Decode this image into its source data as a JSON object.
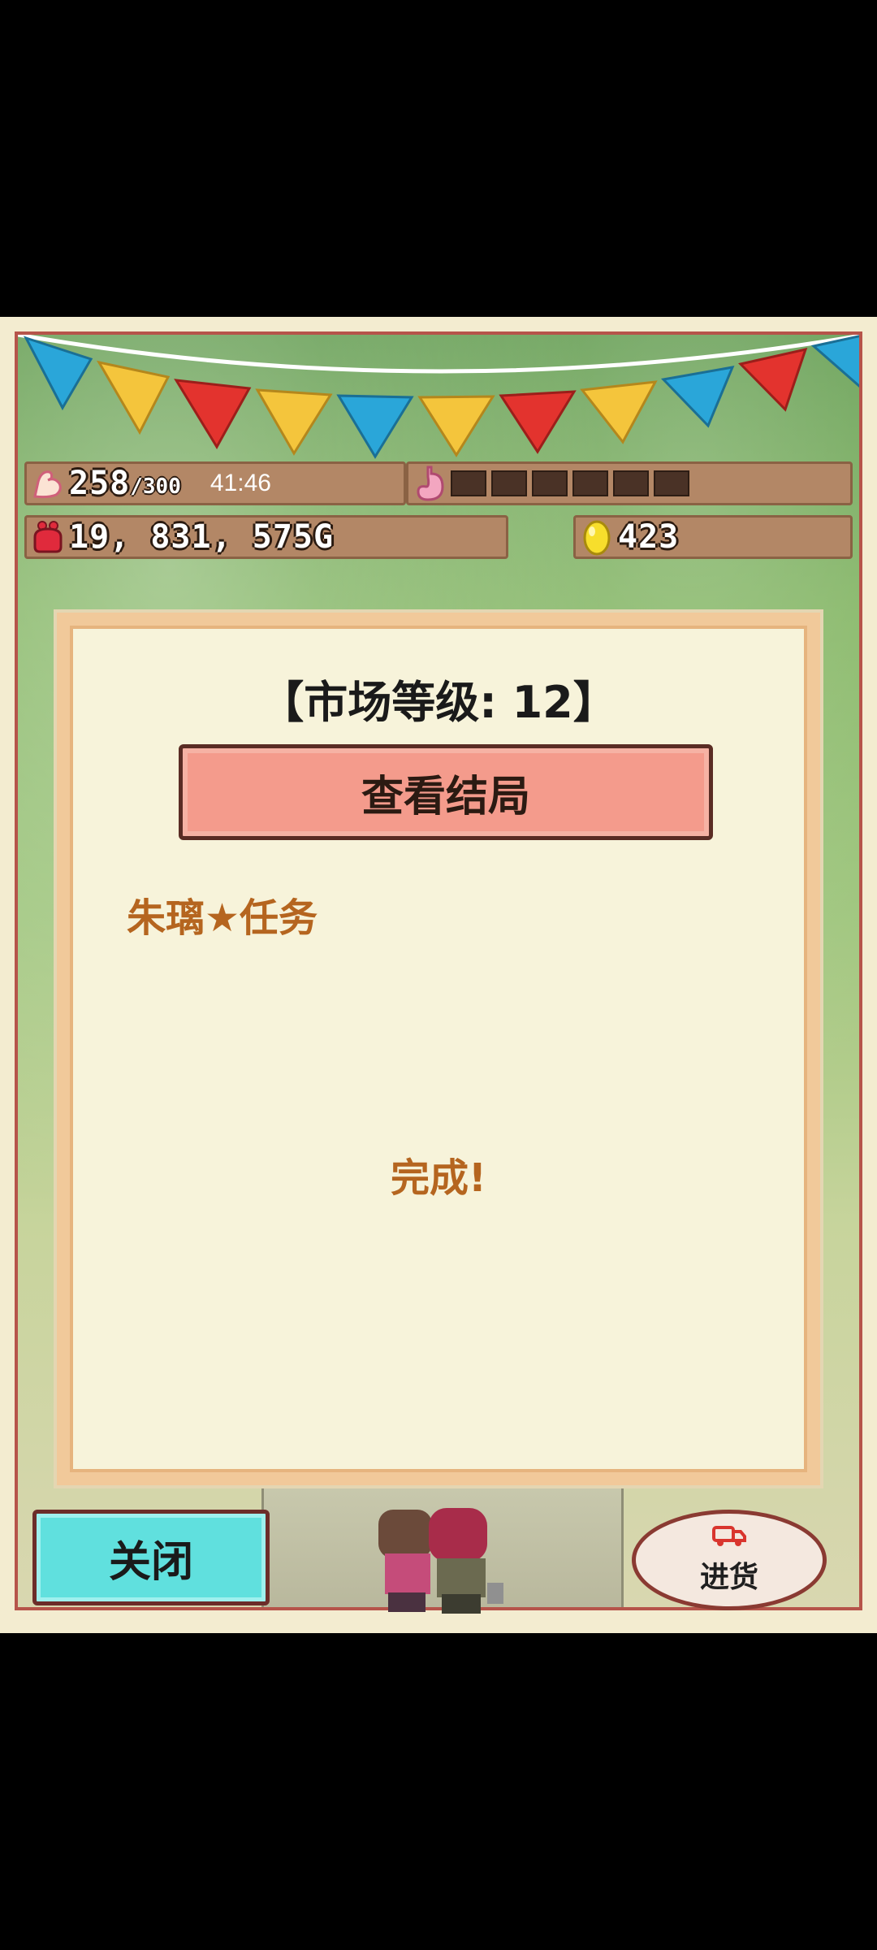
{
  "hud": {
    "stamina": "258",
    "stamina_max": "/300",
    "timer": "41:46",
    "hunger_level": 0,
    "gold": "19, 831, 575G",
    "eggs": "423"
  },
  "dialog": {
    "title": "【市场等级: 12】",
    "ending_button": "查看结局",
    "quest_label": "朱璃★任务",
    "complete_label": "完成!"
  },
  "controls": {
    "close_label": "关闭",
    "restock_label": "进货"
  },
  "icons": {
    "stamina": "flexing-arm-icon",
    "hunger": "stomach-icon",
    "gold": "coin-purse-icon",
    "eggs": "golden-egg-icon",
    "restock": "delivery-truck-icon"
  },
  "colors": {
    "dialog_bg": "#f7f3da",
    "ending_button": "#f49b8c",
    "close_button": "#60e0de",
    "accent_text": "#b5651f"
  }
}
